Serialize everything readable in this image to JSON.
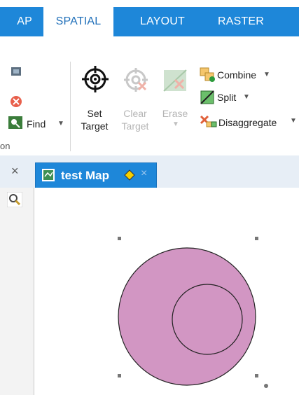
{
  "ribbon_tabs": [
    {
      "label": "AP",
      "active": false
    },
    {
      "label": "SPATIAL",
      "active": true
    },
    {
      "label": "LAYOUT",
      "active": false
    },
    {
      "label": "RASTER",
      "active": false
    }
  ],
  "left_group": {
    "find_label": "Find",
    "group_label_partial": "on"
  },
  "targeting": {
    "set_target_line1": "Set",
    "set_target_line2": "Target",
    "clear_target_line1": "Clear",
    "clear_target_line2": "Target",
    "erase_label": "Erase"
  },
  "editing": {
    "combine_label": "Combine",
    "split_label": "Split",
    "disaggregate_label": "Disaggregate"
  },
  "document_tab": {
    "title": "test Map",
    "close_glyph": "×"
  },
  "panel": {
    "close_glyph": "×"
  },
  "colors": {
    "ribbon_blue": "#1e87d9",
    "active_tab_text": "#1f6fb9",
    "shape_fill": "#d296c3",
    "shape_stroke": "#222222",
    "pin_diamond": "#f5d000"
  },
  "icons": {
    "find": "find-icon",
    "set_target": "crosshair-target-icon",
    "clear_target": "clear-target-icon",
    "erase": "erase-icon",
    "combine": "combine-icon",
    "split": "split-icon",
    "disaggregate": "disaggregate-icon",
    "map": "map-icon",
    "search": "search-icon"
  }
}
